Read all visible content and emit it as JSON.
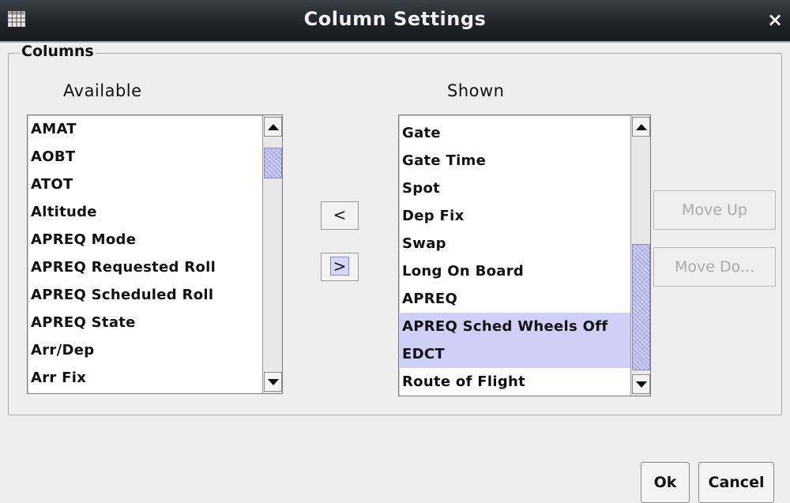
{
  "window": {
    "title": "Column Settings",
    "close_glyph": "×",
    "app_icon": "table-icon"
  },
  "columns_group": {
    "title": "Columns"
  },
  "available": {
    "header": "Available",
    "items": [
      "AMAT",
      "AOBT",
      "ATOT",
      "Altitude",
      "APREQ Mode",
      "APREQ Requested Roll",
      "APREQ Scheduled Roll",
      "APREQ State",
      "Arr/Dep",
      "Arr Fix"
    ]
  },
  "shown": {
    "header": "Shown",
    "items": [
      {
        "label": "Gate",
        "selected": false
      },
      {
        "label": "Gate Time",
        "selected": false
      },
      {
        "label": "Spot",
        "selected": false
      },
      {
        "label": "Dep Fix",
        "selected": false
      },
      {
        "label": "Swap",
        "selected": false
      },
      {
        "label": "Long On Board",
        "selected": false
      },
      {
        "label": "APREQ",
        "selected": false
      },
      {
        "label": "APREQ Sched Wheels Off",
        "selected": true
      },
      {
        "label": "EDCT",
        "selected": true
      },
      {
        "label": "Route of Flight",
        "selected": false
      }
    ]
  },
  "transfer": {
    "remove_label": "<",
    "add_label": ">"
  },
  "order": {
    "move_up_label": "Move Up",
    "move_down_label": "Move Do..."
  },
  "dialog": {
    "ok_label": "Ok",
    "cancel_label": "Cancel"
  },
  "colors": {
    "selection": "#cfcff8",
    "scroll_thumb": "#b9b9ea",
    "titlebar": "#1f2328",
    "disabled_text": "#a9a9a9"
  }
}
